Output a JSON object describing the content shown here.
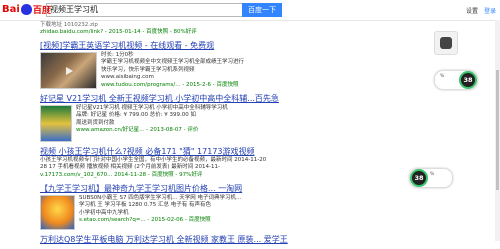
{
  "header": {
    "logo_text": "Bai",
    "logo_text2": "百度",
    "search_value": "视频王学习机",
    "search_button": "百度一下",
    "links": [
      "设置",
      "登录"
    ]
  },
  "results": [
    {
      "lines": [
        "下载地址 1010232.zip",
        "zhidao.baidu.com/link? - 2015-01-14 - 百度快照 - 80%好评"
      ]
    },
    {
      "title": "[视频]学霸王英语学习机视频 - 在线观看 - 免费观",
      "desc": [
        "时长: 1分0秒",
        "学霸王学习机视频全中文视频王学习机全部成绩王学习进行",
        "快乐学习，快乐学霸王学习机系列视频",
        "www.aisibaing.com"
      ],
      "url": "www.tudou.com/programs/... - 2015-2-6 - 百度快照"
    },
    {
      "title": "好记星 V21学习机 全新王视频学习机 小学初中高中全科辅...百先急",
      "desc": [
        "好记星V21学习机 视频王学习机 小学初中高中全科辅导学习机",
        "品牌: 好记星  价格: ¥ 799.00 总价: ¥ 399.00 如",
        "周送到货到付款"
      ],
      "url": "www.amazon.cn/好记星... - 2013-08-07 - 评价"
    },
    {
      "title": "视频 小孩王学习机什么?视频 必备171 \"猜\" 17173游戏视频",
      "desc": [
        "小孩王学习机视频专门针对中国小学生全国，有中小学生的必备视频，最新时间 2014-11-20",
        "28 17 手机看视频 播放视频 相关视频 (2个月前发表) 最新时间 2014-11-",
        "v.17173.com/v_102_670... 2014-11-28 - 百度快照 - 97%好评"
      ]
    },
    {
      "title": "【九学王学习机】最神奇九学王学习机图片价格... 一淘网",
      "desc": [
        "SUBS0N小霸王 S7 四色版学生学习机...   天学网 电子词典学习机...",
        "学习机 王 学习平板 1280 0.75 汇总 电子有 有声有色",
        "小学初中高中九学机"
      ],
      "url": "s.etao.com/search?q=... - 2015-02-06 - 百度快照"
    },
    {
      "title": "万利达Q8学生平板电脑 万利达学习机 全新视频 家教王 原装... 爱学王"
    }
  ],
  "widgets": {
    "speed_value_1": "38",
    "speed_label_1": "%",
    "speed_value_2": "38",
    "speed_label_2": "%"
  },
  "colors": {
    "link": "#2440b3",
    "url": "#008000",
    "highlight": "#cc0000",
    "button": "#3385ff"
  }
}
